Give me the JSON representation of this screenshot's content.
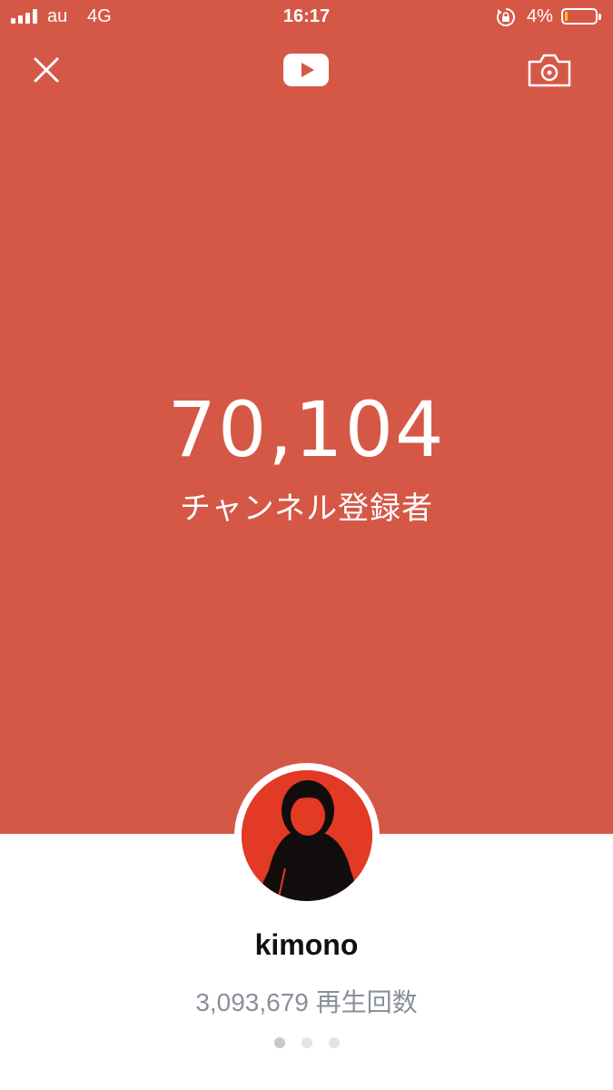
{
  "status_bar": {
    "carrier": "au",
    "network": "4G",
    "time": "16:17",
    "battery_percent": "4%",
    "battery_level": 0.04,
    "battery_color": "#F5C518",
    "icons": [
      "signal-icon",
      "rotation-lock-icon",
      "battery-icon"
    ]
  },
  "toolbar": {
    "left_icon": "close-icon",
    "center_icon": "youtube-logo-icon",
    "right_icon": "camera-icon"
  },
  "stats": {
    "subscriber_count": "70,104",
    "subscriber_label": "チャンネル登録者"
  },
  "channel": {
    "name": "kimono",
    "views_line": "3,093,679 再生回数",
    "avatar_color": "#E23A25"
  },
  "pager": {
    "pages": 3,
    "active_index": 0
  },
  "colors": {
    "hero_background": "#D55847",
    "page_background": "#FFFFFF",
    "views_text": "#8A8F99"
  }
}
